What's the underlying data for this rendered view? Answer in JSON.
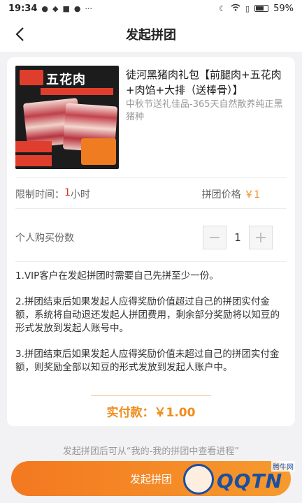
{
  "status_bar": {
    "time": "19:34",
    "battery": "59%"
  },
  "header": {
    "title": "发起拼团"
  },
  "product": {
    "image_title": "五花肉",
    "name": "徒河黑猪肉礼包【前腿肉+五花肉+肉馅+大排（送棒骨）】",
    "subtitle": "中秋节送礼佳品-365天自然散养纯正黑猪种"
  },
  "limit": {
    "label": "限制时间：",
    "value": "1",
    "unit": "小时"
  },
  "price": {
    "label": "拼团价格",
    "value": "￥1"
  },
  "quantity": {
    "label": "个人购买份数",
    "value": "1",
    "minus": "−",
    "plus": "+"
  },
  "rules": [
    "1.VIP客户在发起拼团时需要自己先拼至少一份。",
    "2.拼团结束后如果发起人应得奖励价值超过自己的拼团实付金额，系统将自动退还发起人拼团费用，剩余部分奖励将以知豆的形式发放到发起人账号中。",
    "3.拼团结束后如果发起人应得奖励价值未超过自己的拼团实付金额，则奖励全部以知豆的形式发放到发起人账户中。"
  ],
  "payment": {
    "total": "实付款：￥1.00"
  },
  "footer": {
    "hint": "发起拼团后可从“我的-我的拼团中查看进程”",
    "submit_label": "发起拼团"
  },
  "watermark": {
    "brand": "QQTN",
    "sub": "腾牛网"
  }
}
